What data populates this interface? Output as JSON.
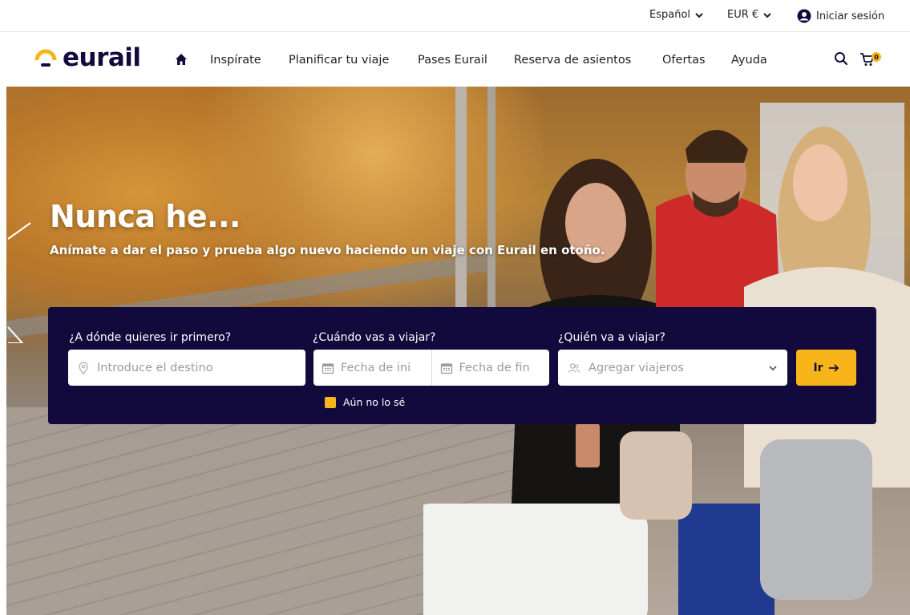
{
  "utility": {
    "language": "Español",
    "currency": "EUR €",
    "login": "Iniciar sesión"
  },
  "brand": {
    "logo_text": "eurail"
  },
  "nav": {
    "items": [
      {
        "label": "Inspírate"
      },
      {
        "label": "Planificar tu viaje"
      },
      {
        "label": "Pases Eurail"
      },
      {
        "label": "Reserva de asientos"
      },
      {
        "label": "Ofertas"
      },
      {
        "label": "Ayuda"
      }
    ],
    "cart_count": "0"
  },
  "hero": {
    "title": "Nunca he...",
    "subtitle": "Anímate a dar el paso y prueba algo nuevo haciendo un viaje con Eurail en otoño."
  },
  "search": {
    "destination_label": "¿A dónde quieres ir primero?",
    "destination_placeholder": "Introduce el destino",
    "dates_label": "¿Cuándo vas a viajar?",
    "start_date_placeholder": "Fecha de ini",
    "end_date_placeholder": "Fecha de fin",
    "travelers_label": "¿Quién va a viajar?",
    "travelers_placeholder": "Agregar viajeros",
    "go_label": "Ir",
    "unsure_label": "Aún no lo sé"
  },
  "colors": {
    "brand_navy": "#120a3d",
    "accent_yellow": "#f7b51a"
  },
  "icons": [
    "chevron-down-icon",
    "user-icon",
    "home-icon",
    "search-icon",
    "cart-icon",
    "location-pin-icon",
    "calendar-icon",
    "travelers-icon",
    "arrow-right-icon"
  ]
}
